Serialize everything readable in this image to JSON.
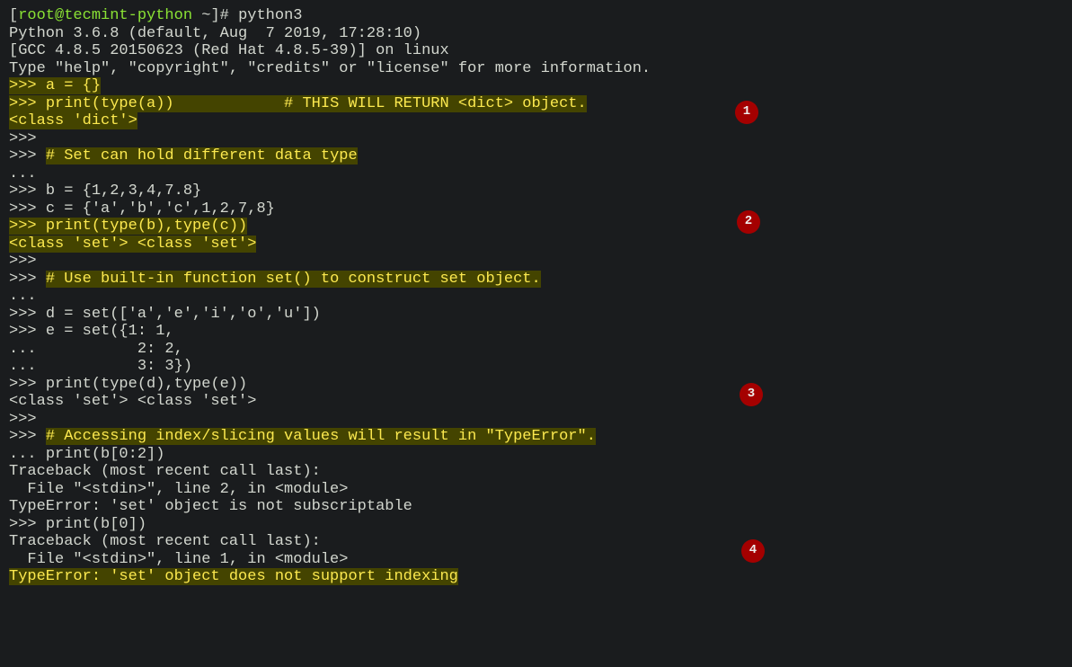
{
  "terminal": {
    "prompt_user": "root@tecmint-python",
    "prompt_path": "~",
    "prompt_suffix": "]# ",
    "command": "python3",
    "python_version": "Python 3.6.8 (default, Aug  7 2019, 17:28:10)",
    "gcc_line": "[GCC 4.8.5 20150623 (Red Hat 4.8.5-39)] on linux",
    "help_line": "Type \"help\", \"copyright\", \"credits\" or \"license\" for more information.",
    "ps1": ">>> ",
    "ps2": "... ",
    "l1": "a = {}",
    "l2a": "print(type(a))",
    "l2b": "            # THIS WILL RETURN <dict> object.",
    "l3": "<class 'dict'>",
    "l4": "# Set can hold different data type",
    "l5": "b = {1,2,3,4,7.8}",
    "l6": "c = {'a','b','c',1,2,7,8}",
    "l7": "print(type(b),type(c))",
    "l8": "<class 'set'> <class 'set'>",
    "l9": "# Use built-in function set() to construct set object.",
    "l10": "d = set(['a','e','i','o','u'])",
    "l11": "e = set({1: 1,",
    "l12": "          2: 2,",
    "l13": "          3: 3})",
    "l14": "print(type(d),type(e))",
    "l15": "<class 'set'> <class 'set'>",
    "l16": "# Accessing index/slicing values will result in \"TypeError\".",
    "l17": "print(b[0:2])",
    "l18": "Traceback (most recent call last):",
    "l19": "  File \"<stdin>\", line 2, in <module>",
    "l20": "TypeError: 'set' object is not subscriptable",
    "l21": "print(b[0])",
    "l22": "Traceback (most recent call last):",
    "l23": "  File \"<stdin>\", line 1, in <module>",
    "l24": "TypeError: 'set' object does not support indexing"
  },
  "badges": {
    "b1": "1",
    "b2": "2",
    "b3": "3",
    "b4": "4"
  }
}
